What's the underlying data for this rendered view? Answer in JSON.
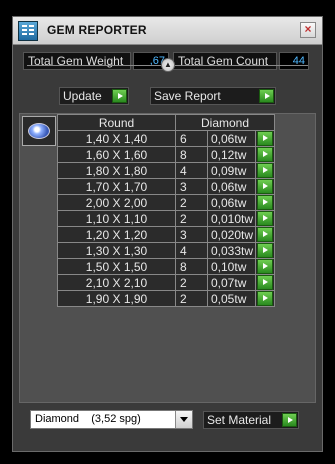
{
  "window": {
    "title": "GEM REPORTER",
    "close_glyph": "×"
  },
  "stats": {
    "weight_label": "Total Gem Weight",
    "weight_value": ",67",
    "count_label": "Total Gem Count",
    "count_value": "44"
  },
  "toolbar": {
    "update_label": "Update",
    "save_label": "Save Report"
  },
  "table": {
    "columns": [
      "Round",
      "Diamond"
    ],
    "rows": [
      {
        "size": "1,40 X 1,40",
        "count": "6",
        "weight": "0,06tw"
      },
      {
        "size": "1,60 X 1,60",
        "count": "8",
        "weight": "0,12tw"
      },
      {
        "size": "1,80 X 1,80",
        "count": "4",
        "weight": "0,09tw"
      },
      {
        "size": "1,70 X 1,70",
        "count": "3",
        "weight": "0,06tw"
      },
      {
        "size": "2,00 X 2,00",
        "count": "2",
        "weight": "0,06tw"
      },
      {
        "size": "1,10 X 1,10",
        "count": "2",
        "weight": "0,010tw"
      },
      {
        "size": "1,20 X 1,20",
        "count": "3",
        "weight": "0,020tw"
      },
      {
        "size": "1,30 X 1,30",
        "count": "4",
        "weight": "0,033tw"
      },
      {
        "size": "1,50 X 1,50",
        "count": "8",
        "weight": "0,10tw"
      },
      {
        "size": "2,10 X 2,10",
        "count": "2",
        "weight": "0,07tw"
      },
      {
        "size": "1,90 X 1,90",
        "count": "2",
        "weight": "0,05tw"
      }
    ]
  },
  "material": {
    "selected": "Diamond    (3,52 spg)",
    "set_label": "Set Material"
  },
  "icons": {
    "app": "app-icon",
    "close": "close-icon",
    "collapse": "chevron-up-icon",
    "go": "play-arrow-icon",
    "gem": "round-gem-icon",
    "dropdown": "chevron-down-icon"
  },
  "colors": {
    "value_text": "#4fb8ff",
    "accent_green": "#3ea82c"
  }
}
